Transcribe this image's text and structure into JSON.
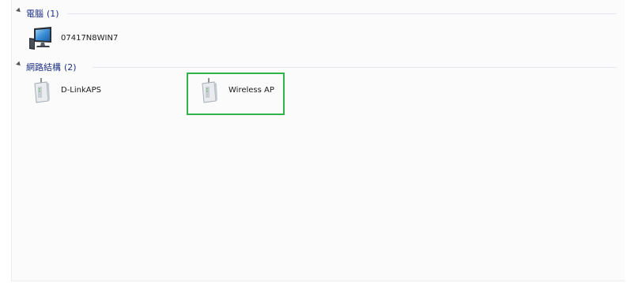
{
  "groups": [
    {
      "title": "電腦",
      "count": "(1)",
      "items": [
        {
          "label": "07417N8WIN7",
          "icon": "computer-icon"
        }
      ]
    },
    {
      "title": "網路結構",
      "count": "(2)",
      "items": [
        {
          "label": "D-LinkAPS",
          "icon": "router-icon"
        },
        {
          "label": "Wireless AP",
          "icon": "router-icon"
        }
      ]
    }
  ],
  "highlight_color": "#2fb34a"
}
